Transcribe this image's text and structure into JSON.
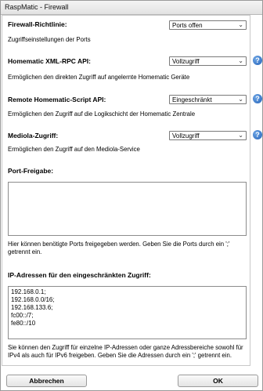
{
  "window": {
    "title": "RaspMatic - Firewall"
  },
  "firewall": {
    "label": "Firewall-Richtlinie:",
    "value": "Ports offen",
    "desc": "Zugriffseinstellungen der Ports"
  },
  "xmlrpc": {
    "label": "Homematic XML-RPC API:",
    "value": "Vollzugriff",
    "desc": "Ermöglichen den direkten Zugriff auf angelernte Homematic Geräte"
  },
  "script": {
    "label": "Remote Homematic-Script API:",
    "value": "Eingeschränkt",
    "desc": "Ermöglichen den Zugriff auf die Logikschicht der Homematic Zentrale"
  },
  "mediola": {
    "label": "Mediola-Zugriff:",
    "value": "Vollzugriff",
    "desc": "Ermöglichen den Zugriff auf den Mediola-Service"
  },
  "ports": {
    "label": "Port-Freigabe:",
    "value": "",
    "desc_line1": "Hier können benötigte Ports freigegeben werden. Geben Sie die Ports durch ein ';'",
    "desc_line2": "getrennt ein."
  },
  "ip": {
    "label": "IP-Adressen für den eingeschränkten Zugriff:",
    "lines": [
      "192.168.0.1;",
      "192.168.0.0/16;",
      "192.168.133.6;",
      "fc00::/7;",
      "fe80::/10"
    ],
    "desc_line1": "Sie können den Zugriff für einzelne IP-Adressen oder ganze Adressbereiche sowohl für",
    "desc_line2": "IPv4 als auch für IPv6 freigeben. Geben Sie die Adressen durch ein ';' getrennt ein."
  },
  "buttons": {
    "cancel": "Abbrechen",
    "ok": "OK"
  },
  "icons": {
    "help": "?",
    "chevron": "⌄"
  }
}
